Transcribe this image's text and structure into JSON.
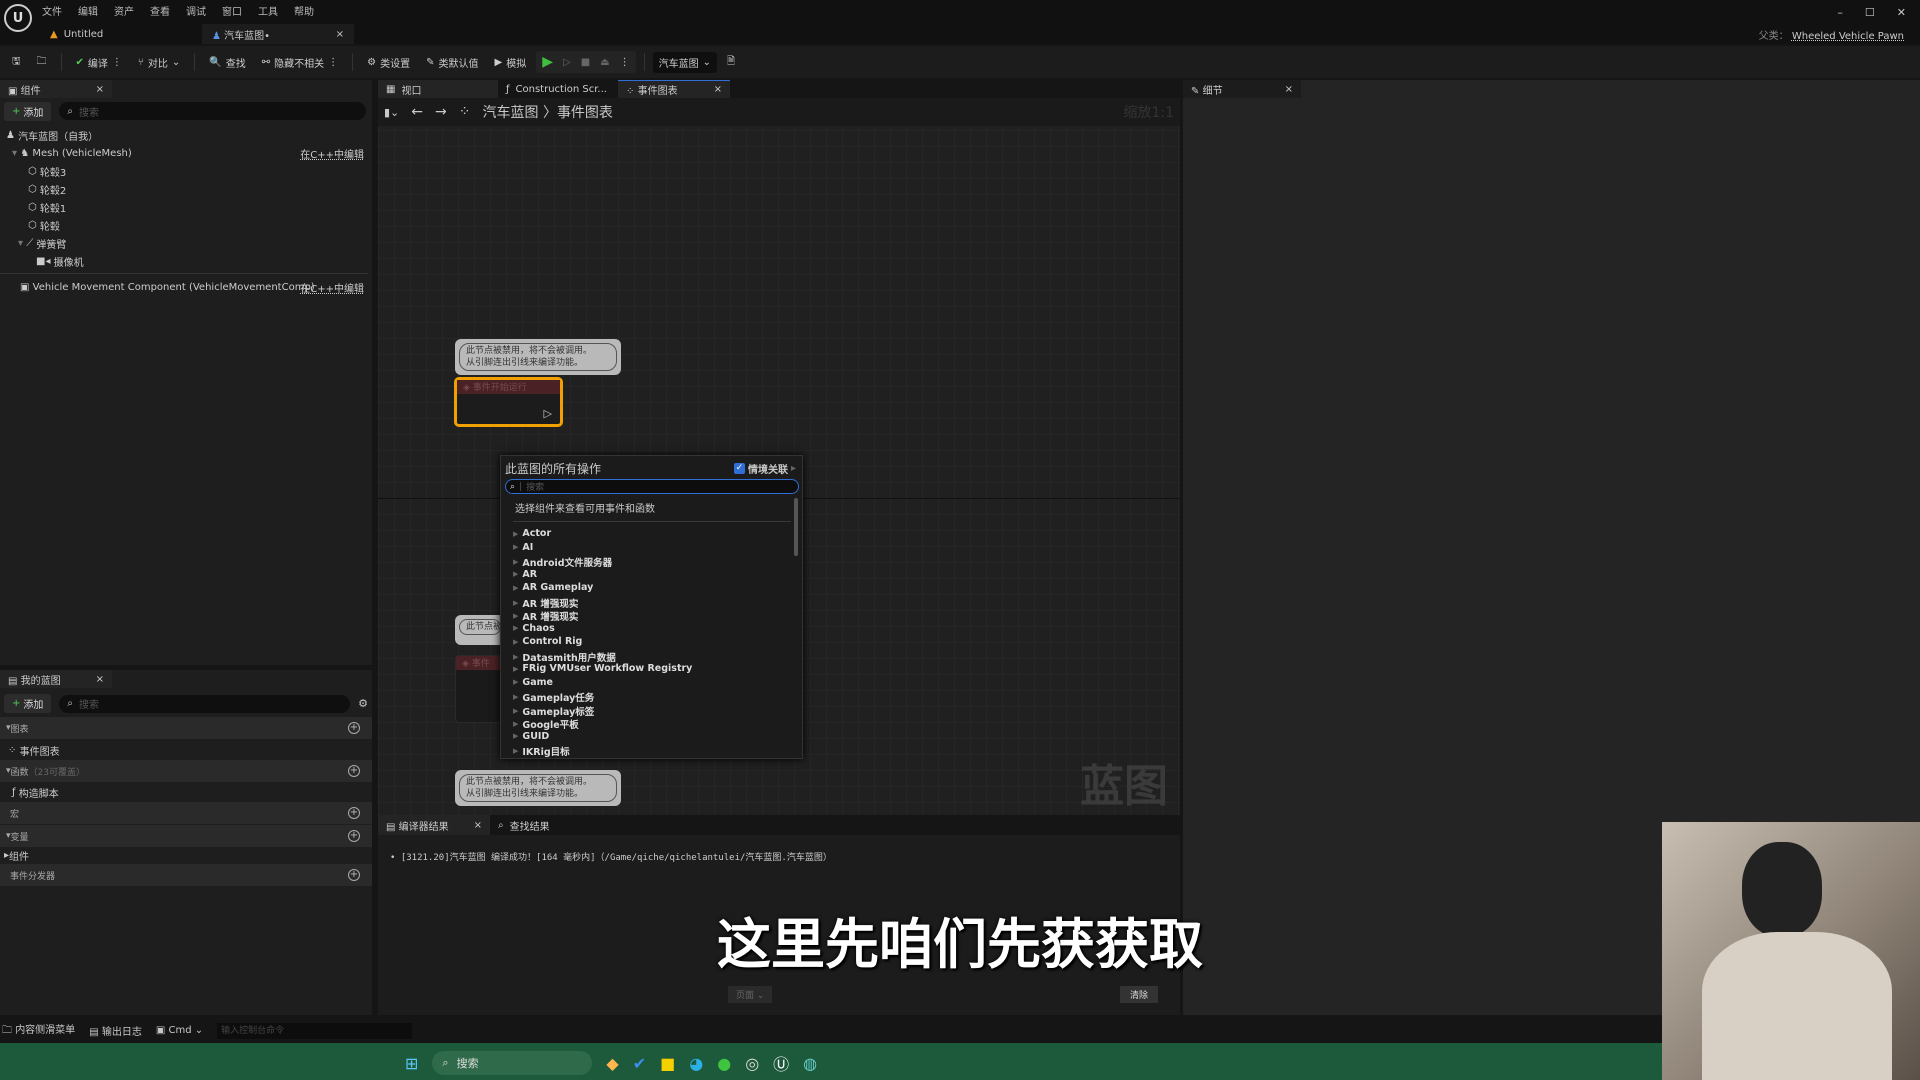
{
  "menu": [
    "文件",
    "编辑",
    "资产",
    "查看",
    "调试",
    "窗口",
    "工具",
    "帮助"
  ],
  "doc_tabs": [
    {
      "label": "Untitled"
    },
    {
      "label": "汽车蓝图•"
    }
  ],
  "window": {
    "parent_label": "父类：",
    "parent_value": "Wheeled Vehicle Pawn"
  },
  "toolbar": {
    "compile": "编译",
    "diff": "对比",
    "find": "查找",
    "hide_unrelated": "隐藏不相关",
    "class_settings": "类设置",
    "class_defaults": "类默认值",
    "simulate": "模拟",
    "blueprint_select": "汽车蓝图"
  },
  "components": {
    "tab": "组件",
    "add": "添加",
    "search_placeholder": "搜索",
    "root": "汽车蓝图（自我）",
    "mesh": "Mesh (VehicleMesh)",
    "edit_cpp": "在C++中编辑",
    "children": [
      "轮毂3",
      "轮毂2",
      "轮毂1",
      "轮毂"
    ],
    "spring_arm": "弹簧臂",
    "camera": "摄像机",
    "movement": "Vehicle Movement Component (VehicleMovementComp)",
    "edit_cpp2": "在C++中编辑"
  },
  "my_blueprint": {
    "tab": "我的蓝图",
    "add": "添加",
    "search_placeholder": "搜索",
    "graphs": "图表",
    "event_graph": "事件图表",
    "functions": "函数",
    "functions_note": "（23可覆盖）",
    "construction": "构造脚本",
    "macros": "宏",
    "variables": "变量",
    "components": "组件",
    "dispatchers": "事件分发器"
  },
  "graph_tabs": [
    "视口",
    "Construction Scr...",
    "事件图表"
  ],
  "breadcrumb": {
    "root": "汽车蓝图",
    "sep": "〉",
    "current": "事件图表",
    "zoom": "缩放1:1"
  },
  "node_comment": "此节点被禁用，将不会被调用。",
  "node_comment2": "从引脚连出引线来编译功能。",
  "node_title": "事件开始运行",
  "node_title2": "事件",
  "watermark": "蓝图",
  "action_menu": {
    "title": "此蓝图的所有操作",
    "context": "情境关联",
    "search_placeholder": "搜索",
    "hint": "选择组件来查看可用事件和函数",
    "items": [
      "Actor",
      "AI",
      "Android文件服务器",
      "AR",
      "AR Gameplay",
      "AR 增强现实",
      "AR 增强现实",
      "Chaos",
      "Control Rig",
      "Datasmith用户数据",
      "FRig VMUser Workflow Registry",
      "Game",
      "Gameplay任务",
      "Gameplay标签",
      "Google平板",
      "GUID",
      "IKRig目标"
    ]
  },
  "details": {
    "tab": "细节"
  },
  "output": {
    "tab1": "编译器结果",
    "tab2": "查找结果",
    "log": "[3121.20]汽车蓝图 编译成功！[164 毫秒内]（/Game/qiche/qichelantulei/汽车蓝图.汽车蓝图）",
    "page": "页面",
    "clear": "清除"
  },
  "statusbar": {
    "drawer": "内容侧滑菜单",
    "output_log": "输出日志",
    "cmd": "Cmd",
    "console_placeholder": "输入控制台命令"
  },
  "taskbar": {
    "search": "搜索"
  },
  "subtitle": "这里先咱们先获获取",
  "colors": {
    "taskbar": "#1d5a3b",
    "play": "#3fbf3f",
    "node_selected": "#f0a000",
    "accent": "#2f6fd6"
  }
}
